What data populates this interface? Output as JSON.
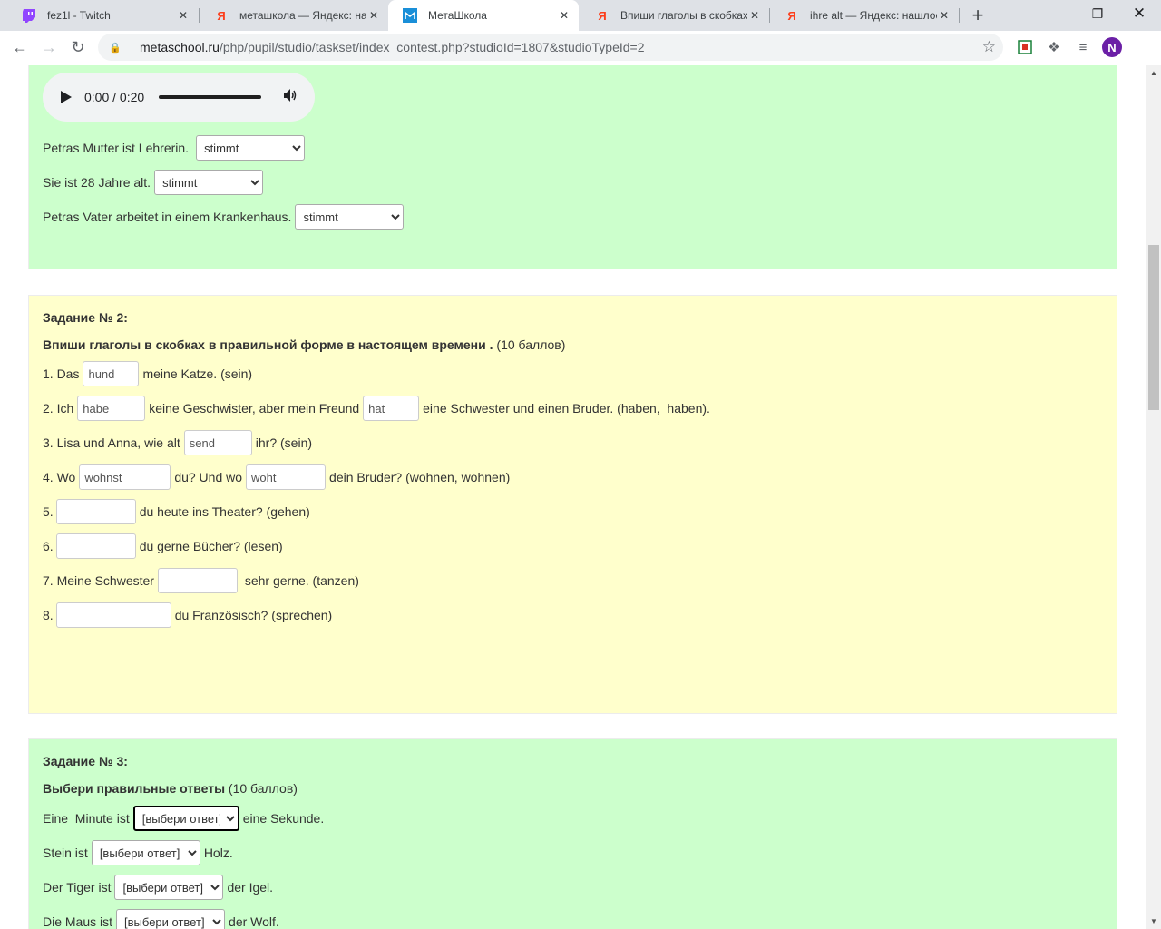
{
  "browser": {
    "tabs": [
      {
        "title": "fez1l - Twitch",
        "icon": "twitch-icon"
      },
      {
        "title": "меташкола — Яндекс: нашл",
        "icon": "yandex-icon"
      },
      {
        "title": "МетаШкола",
        "icon": "metaschool-icon"
      },
      {
        "title": "Впиши глаголы в скобках",
        "icon": "yandex-icon"
      },
      {
        "title": "ihre alt — Яндекс: нашлось",
        "icon": "yandex-icon"
      }
    ],
    "url_host": "metaschool.ru",
    "url_rest": "/php/pupil/studio/taskset/index_contest.php?studioId=1807&studioTypeId=2",
    "profile_initial": "N",
    "twitch_color": "#9146ff",
    "yandex_color": "#fc3f1d",
    "metaschool_color": "#1a8fd8"
  },
  "task1": {
    "audio_time": "0:00 / 0:20",
    "items": [
      {
        "text": "Petras Mutter ist Lehrerin.",
        "value": "stimmt"
      },
      {
        "text": "Sie ist 28 Jahre alt.",
        "value": "stimmt"
      },
      {
        "text": "Petras Vater arbeitet in einem Krankenhaus.",
        "value": "stimmt"
      }
    ]
  },
  "task2": {
    "title": "Задание № 2:",
    "desc_bold": "Впиши глаголы в скобках в правильной форме в настоящем времени .",
    "desc_points": " (10 баллов)",
    "rows": [
      {
        "a": "1. Das",
        "v1": "hund",
        "b": "meine Katze. (sein)"
      },
      {
        "a": "2. Ich",
        "v1": "habe",
        "b": "keine Geschwister, aber mein Freund",
        "v2": "hat",
        "c": "eine Schwester und einen Bruder. (haben,  haben)."
      },
      {
        "a": "3. Lisa und Anna, wie alt",
        "v1": "send",
        "b": "ihr? (sein)"
      },
      {
        "a": "4. Wo",
        "v1": "wohnst",
        "b": "du? Und wo",
        "v2": "woht",
        "c": "dein Bruder? (wohnen, wohnen)"
      },
      {
        "a": "5.",
        "v1": "",
        "b": "du heute ins Theater? (gehen)"
      },
      {
        "a": "6.",
        "v1": "",
        "b": "du gerne Bücher? (lesen)"
      },
      {
        "a": "7. Meine Schwester",
        "v1": "",
        "b": " sehr gerne. (tanzen)"
      },
      {
        "a": "8.",
        "v1": "",
        "b": "du Französisch? (sprechen)"
      }
    ]
  },
  "task3": {
    "title": "Задание № 3:",
    "desc_bold": "Выбери правильные ответы",
    "desc_points": " (10 баллов)",
    "placeholder": "[выбери ответ]",
    "rows": [
      {
        "a": "Eine  Minute ist",
        "b": "eine Sekunde."
      },
      {
        "a": "Stein ist",
        "b": "Holz."
      },
      {
        "a": "Der Tiger ist",
        "b": "der Igel."
      },
      {
        "a": "Die Maus ist",
        "b": "der Wolf."
      }
    ]
  }
}
